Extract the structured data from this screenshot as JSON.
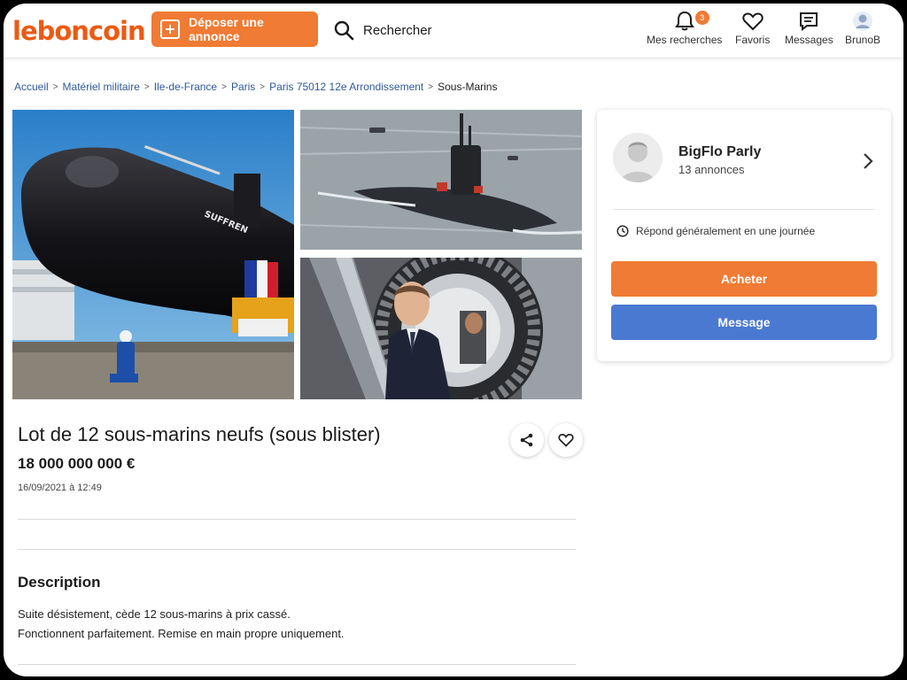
{
  "colors": {
    "brand": "#ec5a13",
    "primary_action": "#ef7b34",
    "secondary_action": "#4a79d1"
  },
  "header": {
    "logo": "leboncoin",
    "post_label": "Déposer une annonce",
    "search_label": "Rechercher",
    "nav": [
      {
        "label": "Mes recherches",
        "icon": "bell-icon",
        "badge": "3"
      },
      {
        "label": "Favoris",
        "icon": "heart-icon"
      },
      {
        "label": "Messages",
        "icon": "message-icon"
      },
      {
        "label": "BrunoB",
        "icon": "user-avatar-icon"
      }
    ]
  },
  "breadcrumb": {
    "items": [
      "Accueil",
      "Matériel militaire",
      "Ile-de-France",
      "Paris",
      "Paris 75012 12e Arrondissement"
    ],
    "current": "Sous-Marins",
    "separator": ">"
  },
  "photos": {
    "main": {
      "hull_text": "SUFFREN"
    }
  },
  "listing": {
    "title": "Lot de 12 sous-marins neufs (sous blister)",
    "price": "18 000 000 000 €",
    "date": "16/09/2021 à 12:49"
  },
  "description": {
    "heading": "Description",
    "lines": [
      "Suite désistement, cède 12 sous-marins à prix cassé.",
      "Fonctionnent parfaitement. Remise en main propre uniquement."
    ]
  },
  "seller": {
    "name": "BigFlo Parly",
    "listings_count": "13 annonces",
    "response_time": "Répond généralement en une journée",
    "buy_label": "Acheter",
    "message_label": "Message"
  }
}
